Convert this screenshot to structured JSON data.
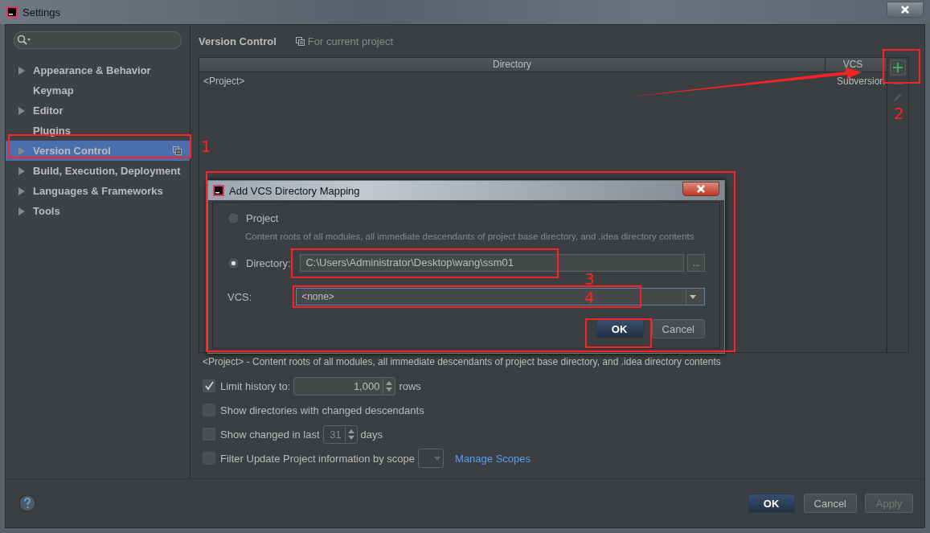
{
  "window": {
    "title": "Settings"
  },
  "sidebar": {
    "items": [
      {
        "label": "Appearance & Behavior",
        "expandable": true,
        "selected": false,
        "project_scoped": false
      },
      {
        "label": "Keymap",
        "expandable": false,
        "selected": false,
        "project_scoped": false
      },
      {
        "label": "Editor",
        "expandable": true,
        "selected": false,
        "project_scoped": false
      },
      {
        "label": "Plugins",
        "expandable": false,
        "selected": false,
        "project_scoped": false
      },
      {
        "label": "Version Control",
        "expandable": true,
        "selected": true,
        "project_scoped": true
      },
      {
        "label": "Build, Execution, Deployment",
        "expandable": true,
        "selected": false,
        "project_scoped": false
      },
      {
        "label": "Languages & Frameworks",
        "expandable": true,
        "selected": false,
        "project_scoped": false
      },
      {
        "label": "Tools",
        "expandable": true,
        "selected": false,
        "project_scoped": false
      }
    ]
  },
  "content": {
    "title": "Version Control",
    "scope": "For current project"
  },
  "table": {
    "columns": [
      "Directory",
      "VCS"
    ],
    "rows": [
      {
        "directory": "<Project>",
        "vcs": "Subversion"
      }
    ]
  },
  "note": "<Project> - Content roots of all modules, all immediate descendants of project base directory, and .idea directory contents",
  "options": [
    {
      "kind": "spinner",
      "label": "Limit history to:",
      "checked": true,
      "value": "1,000",
      "suffix": "rows",
      "disabled": false
    },
    {
      "kind": "plain",
      "label": "Show directories with changed descendants",
      "checked": false
    },
    {
      "kind": "spinner",
      "label": "Show changed in last",
      "checked": false,
      "value": "31",
      "suffix": "days",
      "disabled": true
    },
    {
      "kind": "scope",
      "label": "Filter Update Project information by scope",
      "checked": false,
      "link": "Manage Scopes"
    }
  ],
  "buttons": [
    {
      "label": "OK",
      "primary": true,
      "disabled": false
    },
    {
      "label": "Cancel",
      "primary": false,
      "disabled": false
    },
    {
      "label": "Apply",
      "primary": false,
      "disabled": true
    }
  ],
  "dialog": {
    "title": "Add VCS Directory Mapping",
    "choices": [
      {
        "label": "Project",
        "selected": false,
        "hint": "Content roots of all modules, all immediate descendants of project base directory, and .idea directory contents"
      },
      {
        "label": "Directory:",
        "selected": true,
        "value": "C:\\Users\\Administrator\\Desktop\\wang\\ssm01",
        "browse": "..."
      }
    ],
    "vcs_label": "VCS:",
    "vcs_value": "<none>",
    "buttons": [
      {
        "label": "OK",
        "primary": true
      },
      {
        "label": "Cancel",
        "primary": false
      }
    ]
  },
  "annotations": [
    {
      "label": "1"
    },
    {
      "label": "2"
    },
    {
      "label": "3"
    },
    {
      "label": "4"
    }
  ]
}
